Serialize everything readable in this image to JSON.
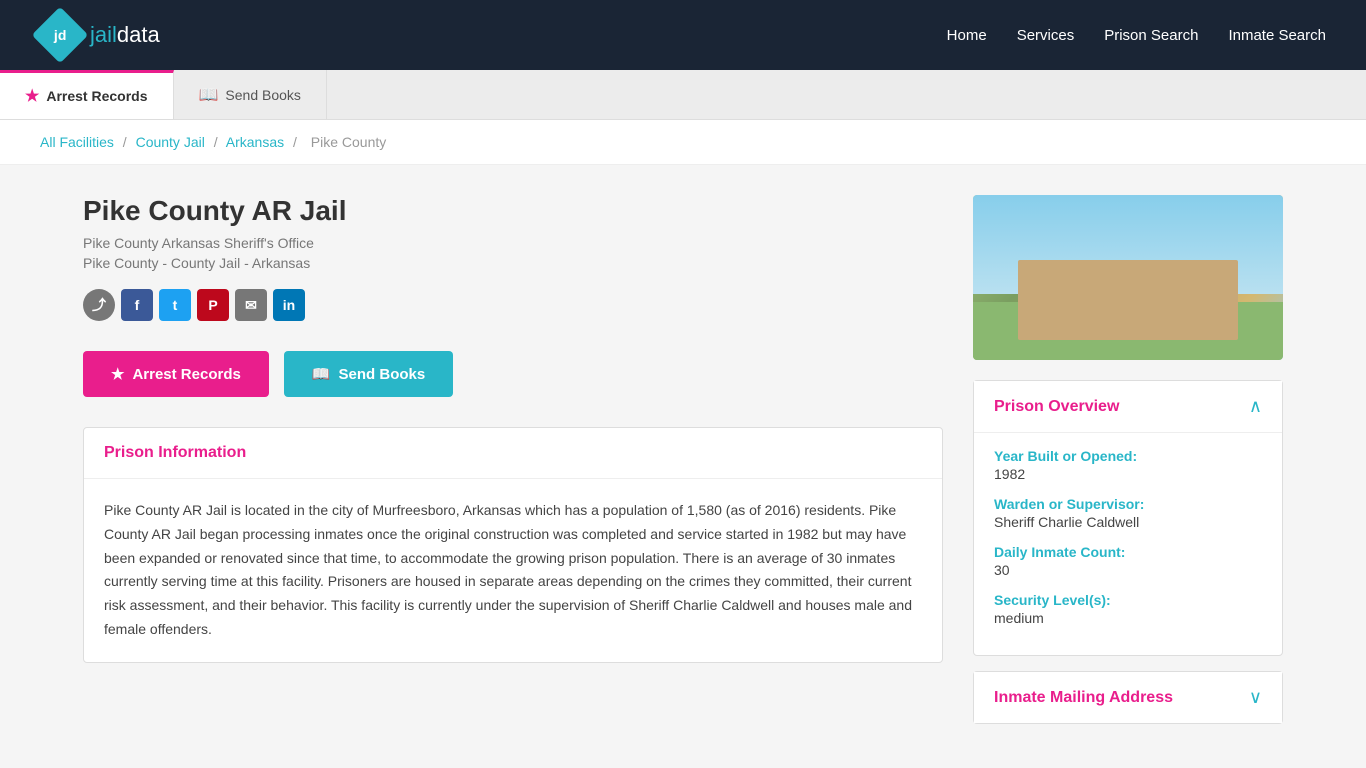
{
  "brand": {
    "logo_initials": "jd",
    "name_part1": "jail",
    "name_part2": "data"
  },
  "nav": {
    "links": [
      {
        "label": "Home",
        "href": "#"
      },
      {
        "label": "Services",
        "href": "#"
      },
      {
        "label": "Prison Search",
        "href": "#"
      },
      {
        "label": "Inmate Search",
        "href": "#"
      }
    ]
  },
  "tabs": {
    "items": [
      {
        "label": "Arrest Records",
        "icon": "star",
        "active": true
      },
      {
        "label": "Send Books",
        "icon": "book",
        "active": false
      }
    ]
  },
  "breadcrumb": {
    "items": [
      {
        "label": "All Facilities",
        "link": true
      },
      {
        "label": "County Jail",
        "link": true
      },
      {
        "label": "Arkansas",
        "link": true
      },
      {
        "label": "Pike County",
        "link": false
      }
    ]
  },
  "jail": {
    "title": "Pike County AR Jail",
    "subtitle1": "Pike County Arkansas Sheriff's Office",
    "subtitle2": "Pike County - County Jail - Arkansas"
  },
  "action_buttons": {
    "arrest_records": "Arrest Records",
    "send_books": "Send Books"
  },
  "prison_info": {
    "section_title": "Prison Information",
    "body": "Pike County AR Jail is located in the city of Murfreesboro, Arkansas which has a population of 1,580 (as of 2016) residents. Pike County AR Jail began processing inmates once the original construction was completed and service started in 1982 but may have been expanded or renovated since that time, to accommodate the growing prison population. There is an average of 30 inmates currently serving time at this facility. Prisoners are housed in separate areas depending on the crimes they committed, their current risk assessment, and their behavior. This facility is currently under the supervision of Sheriff Charlie Caldwell and houses male and female offenders."
  },
  "prison_overview": {
    "title": "Prison Overview",
    "fields": [
      {
        "label": "Year Built or Opened:",
        "value": "1982"
      },
      {
        "label": "Warden or Supervisor:",
        "value": "Sheriff Charlie Caldwell"
      },
      {
        "label": "Daily Inmate Count:",
        "value": "30"
      },
      {
        "label": "Security Level(s):",
        "value": "medium"
      }
    ]
  },
  "inmate_mailing": {
    "title": "Inmate Mailing Address"
  }
}
